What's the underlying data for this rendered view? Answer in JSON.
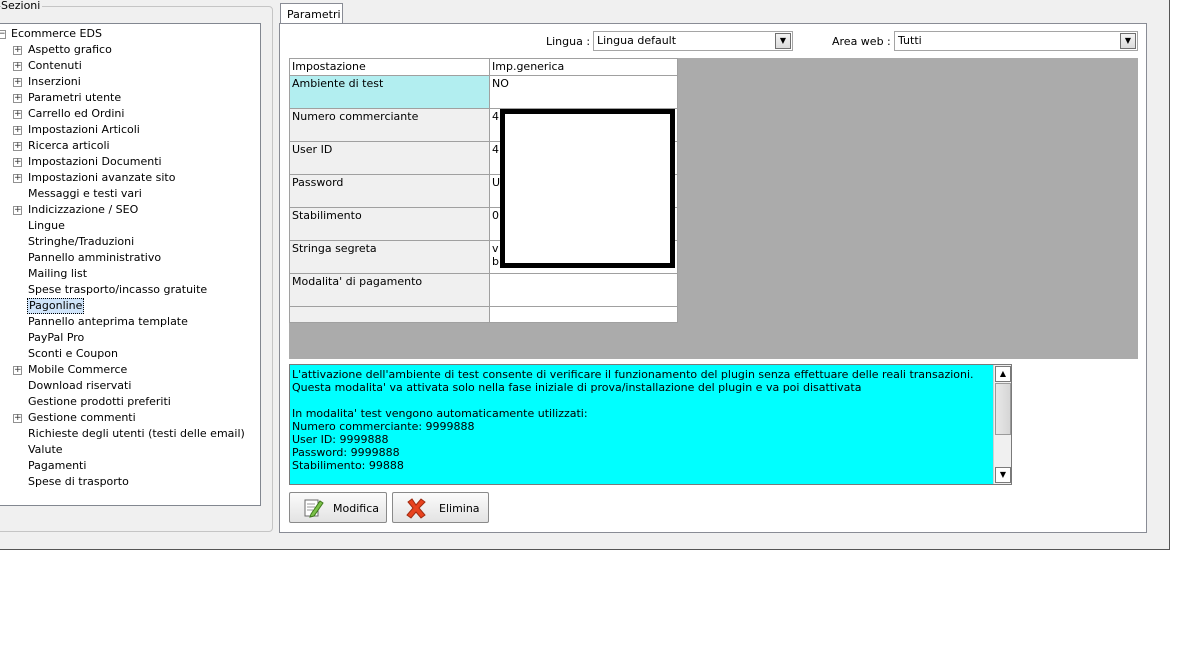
{
  "sidebar": {
    "group_title": "Sezioni",
    "root": "Ecommerce EDS",
    "items": [
      {
        "label": "Aspetto grafico",
        "expandable": true
      },
      {
        "label": "Contenuti",
        "expandable": true
      },
      {
        "label": "Inserzioni",
        "expandable": true
      },
      {
        "label": "Parametri utente",
        "expandable": true
      },
      {
        "label": "Carrello ed Ordini",
        "expandable": true
      },
      {
        "label": "Impostazioni Articoli",
        "expandable": true
      },
      {
        "label": "Ricerca articoli",
        "expandable": true
      },
      {
        "label": "Impostazioni Documenti",
        "expandable": true
      },
      {
        "label": "Impostazioni avanzate sito",
        "expandable": true
      },
      {
        "label": "Messaggi e testi vari",
        "expandable": false
      },
      {
        "label": "Indicizzazione / SEO",
        "expandable": true
      },
      {
        "label": "Lingue",
        "expandable": false
      },
      {
        "label": "Stringhe/Traduzioni",
        "expandable": false
      },
      {
        "label": "Pannello amministrativo",
        "expandable": false
      },
      {
        "label": "Mailing list",
        "expandable": false
      },
      {
        "label": "Spese trasporto/incasso gratuite",
        "expandable": false
      },
      {
        "label": "Pagonline",
        "expandable": false,
        "selected": true
      },
      {
        "label": "Pannello anteprima template",
        "expandable": false
      },
      {
        "label": "PayPal Pro",
        "expandable": false
      },
      {
        "label": "Sconti e Coupon",
        "expandable": false
      },
      {
        "label": "Mobile Commerce",
        "expandable": true
      },
      {
        "label": "Download riservati",
        "expandable": false
      },
      {
        "label": "Gestione prodotti preferiti",
        "expandable": false
      },
      {
        "label": "Gestione commenti",
        "expandable": true
      },
      {
        "label": "Richieste degli utenti (testi delle email)",
        "expandable": false
      },
      {
        "label": "Valute",
        "expandable": false
      },
      {
        "label": "Pagamenti",
        "expandable": false
      },
      {
        "label": "Spese di trasporto",
        "expandable": false
      }
    ]
  },
  "tab": {
    "label": "Parametri"
  },
  "filters": {
    "lingua_label": "Lingua :",
    "lingua_value": "Lingua default",
    "area_label": "Area web :",
    "area_value": "Tutti"
  },
  "grid": {
    "headers": [
      "Impostazione",
      "Imp.generica"
    ],
    "rows": [
      {
        "name": "Ambiente di test",
        "value": "NO"
      },
      {
        "name": "Numero commerciante",
        "value": "4"
      },
      {
        "name": "User ID",
        "value": "4"
      },
      {
        "name": "Password",
        "value": "U"
      },
      {
        "name": "Stabilimento",
        "value": "0"
      },
      {
        "name": "Stringa segreta",
        "value": "v\nb"
      },
      {
        "name": "Modalita' di pagamento",
        "value": ""
      },
      {
        "name": "",
        "value": ""
      }
    ]
  },
  "description": {
    "lines": [
      "L'attivazione dell'ambiente di test consente di verificare il funzionamento del plugin senza effettuare delle reali transazioni.",
      "Questa modalita' va attivata solo nella fase iniziale di prova/installazione del plugin e va poi disattivata",
      "",
      "In modalita' test vengono automaticamente utilizzati:",
      "Numero commerciante: 9999888",
      "User ID: 9999888",
      "Password: 9999888",
      "Stabilimento: 99888"
    ]
  },
  "buttons": {
    "edit": "Modifica",
    "delete": "Elimina"
  },
  "colors": {
    "description_bg": "#00ffff",
    "active_row": "#b2eef0",
    "grid_background": "#ababab"
  }
}
